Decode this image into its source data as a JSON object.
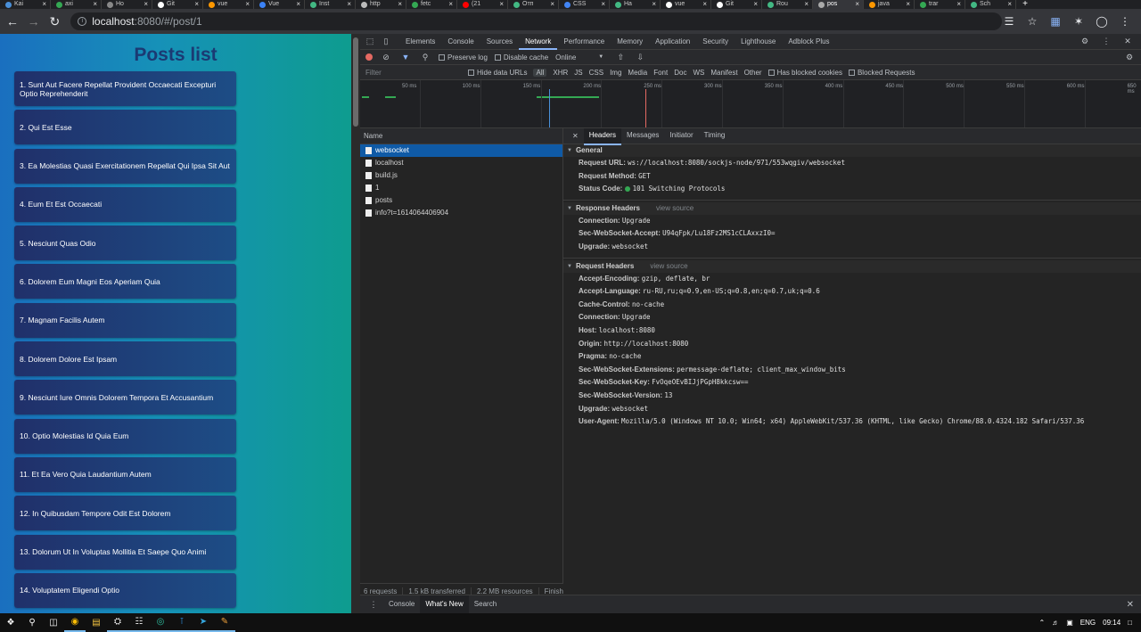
{
  "browser": {
    "tabs": [
      {
        "label": "Kai",
        "color": "#4a90d9"
      },
      {
        "label": "axi",
        "color": "#34a853"
      },
      {
        "label": "Ho",
        "color": "#888888"
      },
      {
        "label": "Git",
        "color": "#ffffff"
      },
      {
        "label": "vue",
        "color": "#ff9800"
      },
      {
        "label": "Vue",
        "color": "#3b82f6"
      },
      {
        "label": "Inst",
        "color": "#42b883"
      },
      {
        "label": "http",
        "color": "#bbbbbb"
      },
      {
        "label": "fetc",
        "color": "#34a853"
      },
      {
        "label": "(21",
        "color": "#ff0000"
      },
      {
        "label": "Отп",
        "color": "#42b883"
      },
      {
        "label": "CSS",
        "color": "#4285f4"
      },
      {
        "label": "Ha",
        "color": "#42b883"
      },
      {
        "label": "vue",
        "color": "#ffffff"
      },
      {
        "label": "Git",
        "color": "#ffffff"
      },
      {
        "label": "Rou",
        "color": "#42b883"
      },
      {
        "label": "pos",
        "color": "#aaaaaa",
        "active": true
      },
      {
        "label": "java",
        "color": "#ff9800"
      },
      {
        "label": "trar",
        "color": "#34a853"
      },
      {
        "label": "Sch",
        "color": "#42b883"
      }
    ],
    "url_host": "localhost",
    "url_path": ":8080/#/post/1"
  },
  "page": {
    "title": "Posts list",
    "posts": [
      "1. Sunt Aut Facere Repellat Provident Occaecati Excepturi Optio Reprehenderit",
      "2. Qui Est Esse",
      "3. Ea Molestias Quasi Exercitationem Repellat Qui Ipsa Sit Aut",
      "4. Eum Et Est Occaecati",
      "5. Nesciunt Quas Odio",
      "6. Dolorem Eum Magni Eos Aperiam Quia",
      "7. Magnam Facilis Autem",
      "8. Dolorem Dolore Est Ipsam",
      "9. Nesciunt Iure Omnis Dolorem Tempora Et Accusantium",
      "10. Optio Molestias Id Quia Eum",
      "11. Et Ea Vero Quia Laudantium Autem",
      "12. In Quibusdam Tempore Odit Est Dolorem",
      "13. Dolorum Ut In Voluptas Mollitia Et Saepe Quo Animi",
      "14. Voluptatem Eligendi Optio"
    ]
  },
  "devtools": {
    "tabs": [
      "Elements",
      "Console",
      "Sources",
      "Network",
      "Performance",
      "Memory",
      "Application",
      "Security",
      "Lighthouse",
      "Adblock Plus"
    ],
    "active_tab": "Network",
    "toolbar": {
      "preserve_log": "Preserve log",
      "disable_cache": "Disable cache",
      "throttle": "Online"
    },
    "filter": {
      "placeholder": "Filter",
      "hide_data_urls": "Hide data URLs",
      "all": "All",
      "types": [
        "XHR",
        "JS",
        "CSS",
        "Img",
        "Media",
        "Font",
        "Doc",
        "WS",
        "Manifest",
        "Other"
      ],
      "has_blocked_cookies": "Has blocked cookies",
      "blocked_requests": "Blocked Requests"
    },
    "timeline_ticks": [
      "50 ms",
      "100 ms",
      "150 ms",
      "200 ms",
      "250 ms",
      "300 ms",
      "350 ms",
      "400 ms",
      "450 ms",
      "500 ms",
      "550 ms",
      "600 ms",
      "650 ms"
    ],
    "name_header": "Name",
    "requests": [
      "websocket",
      "localhost",
      "build.js",
      "1",
      "posts",
      "info?t=1614064406904"
    ],
    "selected_request": "websocket",
    "status_bar": {
      "requests": "6 requests",
      "transferred": "1.5 kB transferred",
      "resources": "2.2 MB resources",
      "finish": "Finish"
    },
    "detail_tabs": [
      "Headers",
      "Messages",
      "Initiator",
      "Timing"
    ],
    "general": {
      "title": "General",
      "rows": [
        {
          "k": "Request URL:",
          "v": "ws://localhost:8080/sockjs-node/971/553wqgiv/websocket"
        },
        {
          "k": "Request Method:",
          "v": "GET"
        },
        {
          "k": "Status Code:",
          "v": "101 Switching Protocols"
        }
      ]
    },
    "response_headers": {
      "title": "Response Headers",
      "view_source": "view source",
      "rows": [
        {
          "k": "Connection:",
          "v": "Upgrade"
        },
        {
          "k": "Sec-WebSocket-Accept:",
          "v": "U94qFpk/Lu18Fz2MS1cCLAxxzI0="
        },
        {
          "k": "Upgrade:",
          "v": "websocket"
        }
      ]
    },
    "request_headers": {
      "title": "Request Headers",
      "view_source": "view source",
      "rows": [
        {
          "k": "Accept-Encoding:",
          "v": "gzip, deflate, br"
        },
        {
          "k": "Accept-Language:",
          "v": "ru-RU,ru;q=0.9,en-US;q=0.8,en;q=0.7,uk;q=0.6"
        },
        {
          "k": "Cache-Control:",
          "v": "no-cache"
        },
        {
          "k": "Connection:",
          "v": "Upgrade"
        },
        {
          "k": "Host:",
          "v": "localhost:8080"
        },
        {
          "k": "Origin:",
          "v": "http://localhost:8080"
        },
        {
          "k": "Pragma:",
          "v": "no-cache"
        },
        {
          "k": "Sec-WebSocket-Extensions:",
          "v": "permessage-deflate; client_max_window_bits"
        },
        {
          "k": "Sec-WebSocket-Key:",
          "v": "FvOqeOEvBIJjPGpH8kkcsw=="
        },
        {
          "k": "Sec-WebSocket-Version:",
          "v": "13"
        },
        {
          "k": "Upgrade:",
          "v": "websocket"
        },
        {
          "k": "User-Agent:",
          "v": "Mozilla/5.0 (Windows NT 10.0; Win64; x64) AppleWebKit/537.36 (KHTML, like Gecko) Chrome/88.0.4324.182 Safari/537.36"
        }
      ]
    },
    "drawer_tabs": [
      "Console",
      "What's New",
      "Search"
    ],
    "drawer_active": "What's New"
  },
  "taskbar": {
    "lang": "ENG",
    "time": "09:14"
  }
}
